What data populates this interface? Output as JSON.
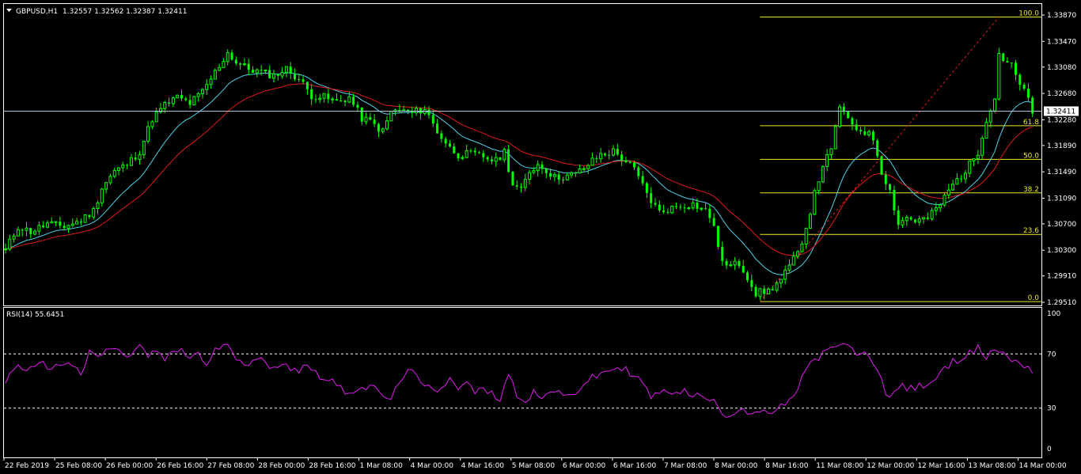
{
  "header": {
    "symbol": "GBPUSD,H1",
    "ohlc": "1.32557 1.32562 1.32387 1.32411"
  },
  "rsi_label": "RSI(14) 55.6451",
  "colors": {
    "background": "#000000",
    "frame": "#ffffff",
    "bull": "#00ff00",
    "ma_fast": "#4fd2e8",
    "ma_slow": "#e01b1b",
    "fib": "#e8e82a",
    "fib_trend": "#e01b1b",
    "rsi": "#e01bef",
    "price_line": "#b0c4de"
  },
  "chart_data": [
    {
      "type": "line",
      "subtype": "candlestick",
      "symbol": "GBPUSD",
      "timeframe": "H1",
      "y_axis": {
        "ticks": [
          "1.33870",
          "1.33470",
          "1.33080",
          "1.32680",
          "1.32280",
          "1.31890",
          "1.31490",
          "1.31090",
          "1.30700",
          "1.30300",
          "1.29910",
          "1.29510"
        ],
        "range": [
          1.2951,
          1.3387
        ]
      },
      "x_axis": {
        "ticks": [
          "22 Feb 2019",
          "25 Feb 08:00",
          "26 Feb 00:00",
          "26 Feb 16:00",
          "27 Feb 08:00",
          "28 Feb 00:00",
          "28 Feb 16:00",
          "1 Mar 08:00",
          "4 Mar 00:00",
          "4 Mar 16:00",
          "5 Mar 08:00",
          "6 Mar 00:00",
          "6 Mar 16:00",
          "7 Mar 08:00",
          "8 Mar 00:00",
          "8 Mar 16:00",
          "11 Mar 08:00",
          "12 Mar 00:00",
          "12 Mar 16:00",
          "13 Mar 08:00",
          "14 Mar 00:00"
        ]
      },
      "current_price": "1.32411",
      "close_path": [
        [
          0,
          1.303
        ],
        [
          3,
          1.3066
        ],
        [
          6,
          1.3058
        ],
        [
          10,
          1.307
        ],
        [
          14,
          1.3066
        ],
        [
          18,
          1.3075
        ],
        [
          21,
          1.309
        ],
        [
          23,
          1.3125
        ],
        [
          26,
          1.315
        ],
        [
          29,
          1.316
        ],
        [
          32,
          1.318
        ],
        [
          35,
          1.323
        ],
        [
          38,
          1.325
        ],
        [
          41,
          1.3262
        ],
        [
          44,
          1.3253
        ],
        [
          47,
          1.327
        ],
        [
          50,
          1.33
        ],
        [
          53,
          1.333
        ],
        [
          55,
          1.3315
        ],
        [
          58,
          1.3305
        ],
        [
          61,
          1.33
        ],
        [
          64,
          1.3295
        ],
        [
          67,
          1.3305
        ],
        [
          70,
          1.329
        ],
        [
          73,
          1.3265
        ],
        [
          76,
          1.3262
        ],
        [
          79,
          1.3255
        ],
        [
          82,
          1.3262
        ],
        [
          85,
          1.323
        ],
        [
          87,
          1.3225
        ],
        [
          90,
          1.321
        ],
        [
          92,
          1.324
        ],
        [
          94,
          1.3242
        ],
        [
          97,
          1.3238
        ],
        [
          100,
          1.3245
        ],
        [
          103,
          1.321
        ],
        [
          106,
          1.3185
        ],
        [
          108,
          1.3175
        ],
        [
          111,
          1.3176
        ],
        [
          114,
          1.3172
        ],
        [
          117,
          1.3165
        ],
        [
          119,
          1.318
        ],
        [
          121,
          1.313
        ],
        [
          123,
          1.312
        ],
        [
          125,
          1.315
        ],
        [
          127,
          1.316
        ],
        [
          129,
          1.3152
        ],
        [
          131,
          1.314
        ],
        [
          133,
          1.3142
        ],
        [
          136,
          1.3145
        ],
        [
          139,
          1.316
        ],
        [
          142,
          1.3175
        ],
        [
          145,
          1.318
        ],
        [
          148,
          1.3165
        ],
        [
          150,
          1.3152
        ],
        [
          152,
          1.3128
        ],
        [
          154,
          1.3105
        ],
        [
          156,
          1.3088
        ],
        [
          158,
          1.3092
        ],
        [
          161,
          1.3098
        ],
        [
          164,
          1.31
        ],
        [
          167,
          1.309
        ],
        [
          169,
          1.307
        ],
        [
          170,
          1.303
        ],
        [
          172,
          1.3005
        ],
        [
          175,
          1.301
        ],
        [
          177,
          1.299
        ],
        [
          179,
          1.2965
        ],
        [
          182,
          1.2968
        ],
        [
          185,
          1.2985
        ],
        [
          187,
          1.3005
        ],
        [
          189,
          1.3025
        ],
        [
          191,
          1.3065
        ],
        [
          193,
          1.3115
        ],
        [
          195,
          1.316
        ],
        [
          197,
          1.318
        ],
        [
          199,
          1.325
        ],
        [
          201,
          1.3225
        ],
        [
          203,
          1.3215
        ],
        [
          205,
          1.321
        ],
        [
          207,
          1.32
        ],
        [
          209,
          1.315
        ],
        [
          211,
          1.312
        ],
        [
          213,
          1.307
        ],
        [
          215,
          1.308
        ],
        [
          217,
          1.3075
        ],
        [
          220,
          1.3078
        ],
        [
          223,
          1.31
        ],
        [
          226,
          1.313
        ],
        [
          229,
          1.315
        ],
        [
          232,
          1.318
        ],
        [
          234,
          1.323
        ],
        [
          236,
          1.326
        ],
        [
          237,
          1.333
        ],
        [
          238,
          1.332
        ],
        [
          240,
          1.331
        ],
        [
          242,
          1.328
        ],
        [
          244,
          1.326
        ],
        [
          245,
          1.3241
        ]
      ],
      "fibonacci": {
        "levels": [
          "100.0",
          "61.8",
          "50.0",
          "38.2",
          "23.6",
          "0.0"
        ],
        "values": [
          1.3384,
          1.3219,
          1.3168,
          1.3117,
          1.3054,
          1.2952
        ]
      },
      "moving_averages": [
        "fast (cyan)",
        "slow (red)"
      ]
    },
    {
      "type": "line",
      "indicator": "RSI(14)",
      "value": "55.6451",
      "y_ticks": [
        "100",
        "70",
        "30",
        "0"
      ],
      "levels": [
        70,
        30
      ],
      "ylim": [
        0,
        100
      ],
      "path": [
        [
          0,
          50
        ],
        [
          3,
          62
        ],
        [
          6,
          58
        ],
        [
          9,
          62
        ],
        [
          12,
          60
        ],
        [
          15,
          65
        ],
        [
          18,
          55
        ],
        [
          20,
          70
        ],
        [
          22,
          68
        ],
        [
          24,
          72
        ],
        [
          26,
          75
        ],
        [
          28,
          68
        ],
        [
          30,
          70
        ],
        [
          32,
          76
        ],
        [
          34,
          68
        ],
        [
          36,
          72
        ],
        [
          38,
          66
        ],
        [
          40,
          70
        ],
        [
          42,
          74
        ],
        [
          44,
          66
        ],
        [
          46,
          72
        ],
        [
          48,
          60
        ],
        [
          50,
          72
        ],
        [
          52,
          78
        ],
        [
          54,
          72
        ],
        [
          56,
          65
        ],
        [
          58,
          64
        ],
        [
          60,
          68
        ],
        [
          62,
          62
        ],
        [
          64,
          58
        ],
        [
          66,
          65
        ],
        [
          68,
          60
        ],
        [
          70,
          58
        ],
        [
          72,
          62
        ],
        [
          75,
          54
        ],
        [
          78,
          50
        ],
        [
          80,
          44
        ],
        [
          82,
          42
        ],
        [
          85,
          46
        ],
        [
          88,
          44
        ],
        [
          90,
          40
        ],
        [
          92,
          35
        ],
        [
          94,
          50
        ],
        [
          96,
          60
        ],
        [
          98,
          52
        ],
        [
          100,
          45
        ],
        [
          103,
          44
        ],
        [
          106,
          52
        ],
        [
          108,
          46
        ],
        [
          110,
          48
        ],
        [
          112,
          42
        ],
        [
          114,
          44
        ],
        [
          116,
          40
        ],
        [
          118,
          38
        ],
        [
          120,
          55
        ],
        [
          122,
          40
        ],
        [
          124,
          36
        ],
        [
          126,
          42
        ],
        [
          128,
          36
        ],
        [
          130,
          44
        ],
        [
          132,
          40
        ],
        [
          134,
          38
        ],
        [
          136,
          42
        ],
        [
          138,
          48
        ],
        [
          140,
          52
        ],
        [
          142,
          55
        ],
        [
          144,
          58
        ],
        [
          146,
          60
        ],
        [
          148,
          58
        ],
        [
          150,
          55
        ],
        [
          152,
          48
        ],
        [
          154,
          38
        ],
        [
          156,
          42
        ],
        [
          158,
          40
        ],
        [
          160,
          44
        ],
        [
          162,
          42
        ],
        [
          164,
          40
        ],
        [
          166,
          38
        ],
        [
          168,
          36
        ],
        [
          170,
          32
        ],
        [
          172,
          24
        ],
        [
          174,
          28
        ],
        [
          176,
          30
        ],
        [
          178,
          26
        ],
        [
          180,
          28
        ],
        [
          182,
          24
        ],
        [
          184,
          30
        ],
        [
          186,
          32
        ],
        [
          188,
          36
        ],
        [
          190,
          55
        ],
        [
          192,
          62
        ],
        [
          194,
          68
        ],
        [
          196,
          72
        ],
        [
          198,
          74
        ],
        [
          200,
          78
        ],
        [
          202,
          72
        ],
        [
          204,
          70
        ],
        [
          206,
          68
        ],
        [
          208,
          60
        ],
        [
          210,
          40
        ],
        [
          212,
          42
        ],
        [
          214,
          46
        ],
        [
          216,
          44
        ],
        [
          218,
          46
        ],
        [
          220,
          48
        ],
        [
          222,
          52
        ],
        [
          224,
          58
        ],
        [
          226,
          64
        ],
        [
          228,
          68
        ],
        [
          230,
          70
        ],
        [
          232,
          74
        ],
        [
          234,
          68
        ],
        [
          236,
          74
        ],
        [
          238,
          70
        ],
        [
          240,
          66
        ],
        [
          242,
          64
        ],
        [
          245,
          58
        ]
      ]
    }
  ]
}
